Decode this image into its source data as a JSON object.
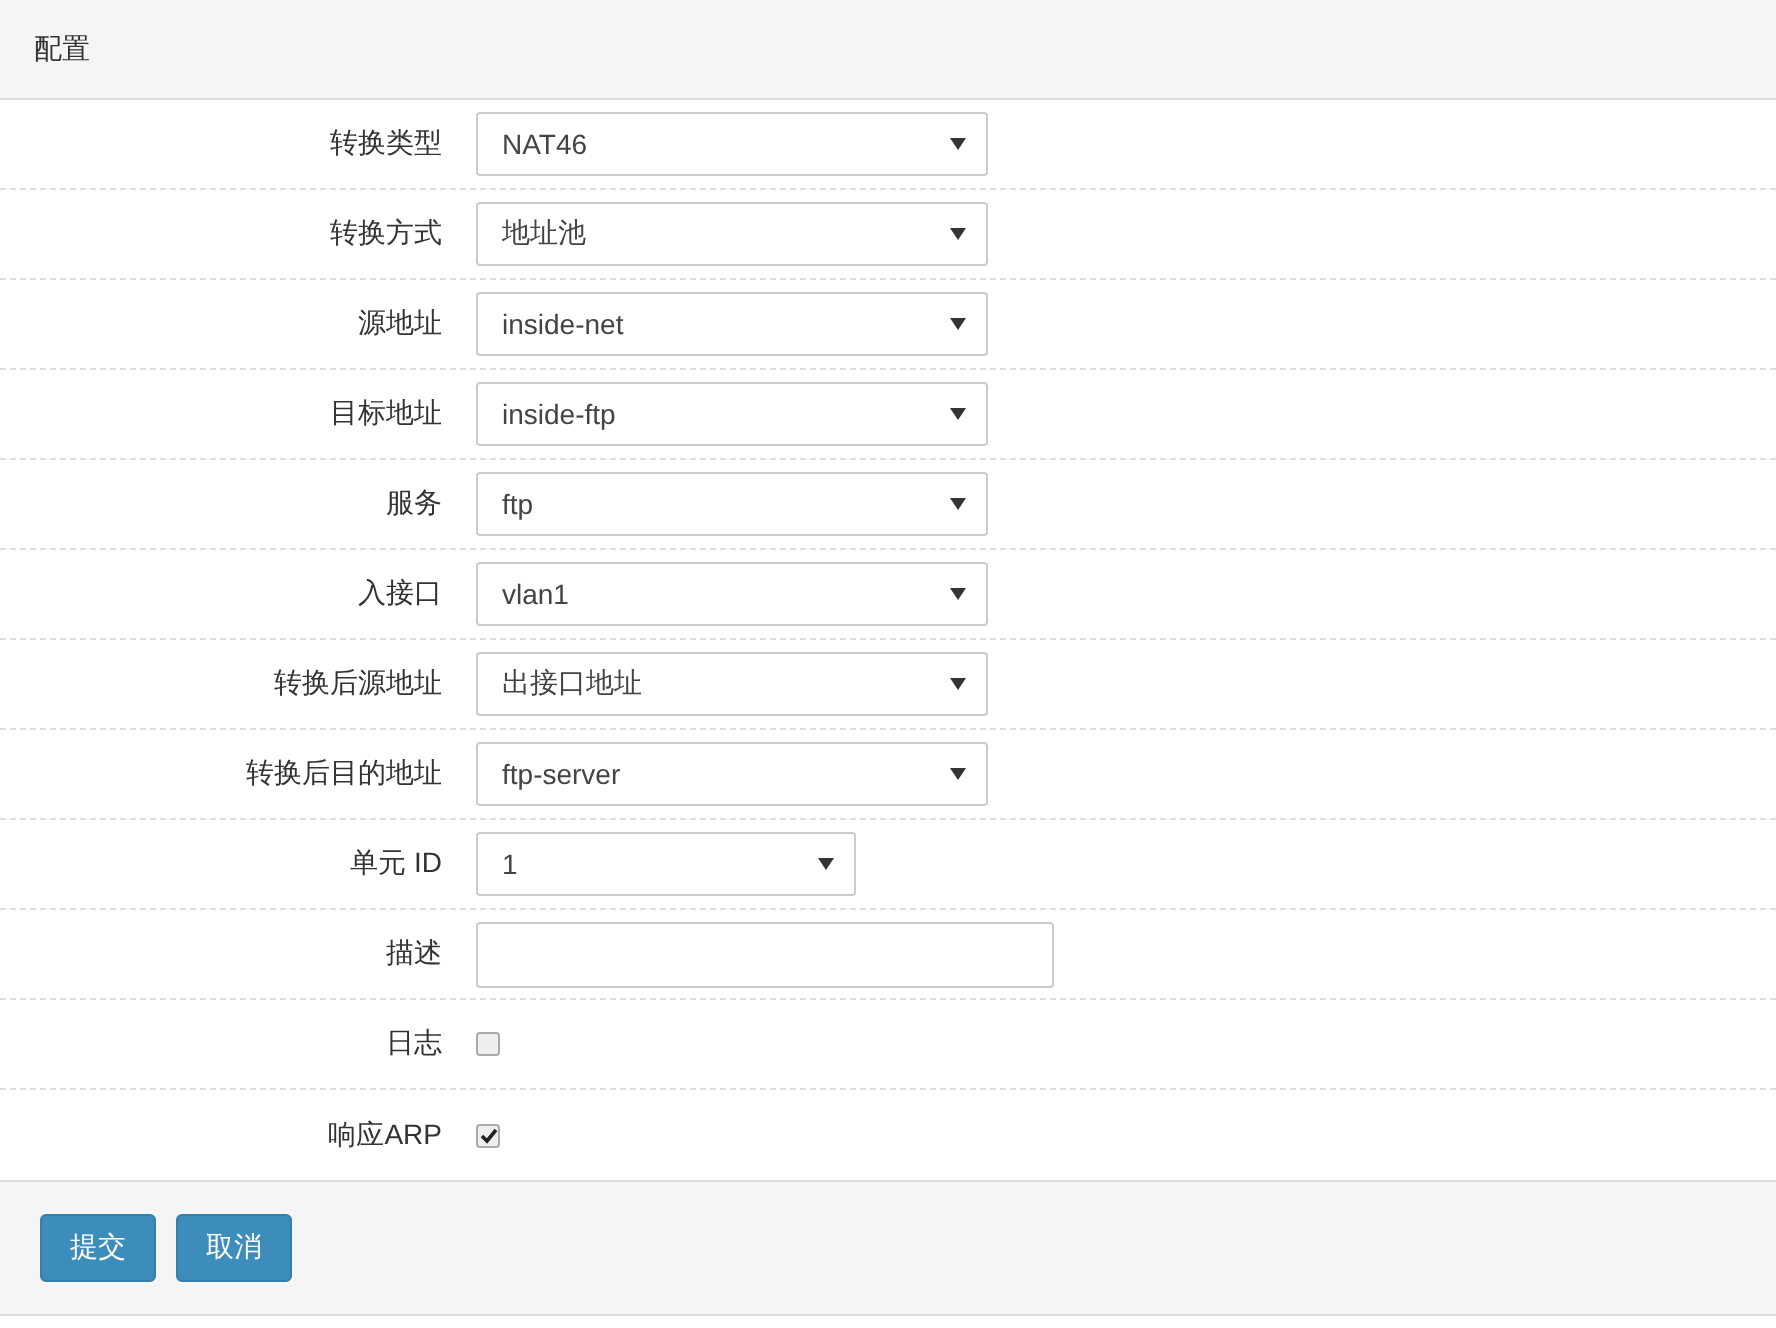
{
  "panel": {
    "title": "配置"
  },
  "fields": [
    {
      "label": "转换类型",
      "kind": "select",
      "value": "NAT46",
      "narrow": false
    },
    {
      "label": "转换方式",
      "kind": "select",
      "value": "地址池",
      "narrow": false
    },
    {
      "label": "源地址",
      "kind": "select",
      "value": "inside-net",
      "narrow": false
    },
    {
      "label": "目标地址",
      "kind": "select",
      "value": "inside-ftp",
      "narrow": false
    },
    {
      "label": "服务",
      "kind": "select",
      "value": "ftp",
      "narrow": false
    },
    {
      "label": "入接口",
      "kind": "select",
      "value": "vlan1",
      "narrow": false
    },
    {
      "label": "转换后源地址",
      "kind": "select",
      "value": "出接口地址",
      "narrow": false
    },
    {
      "label": "转换后目的地址",
      "kind": "select",
      "value": "ftp-server",
      "narrow": false
    },
    {
      "label": "单元 ID",
      "kind": "select",
      "value": "1",
      "narrow": true
    },
    {
      "label": "描述",
      "kind": "text"
    },
    {
      "label": "日志",
      "kind": "checkbox",
      "checked": false
    },
    {
      "label": "响应ARP",
      "kind": "checkbox",
      "checked": true
    }
  ],
  "buttons": [
    "提交",
    "取消"
  ]
}
